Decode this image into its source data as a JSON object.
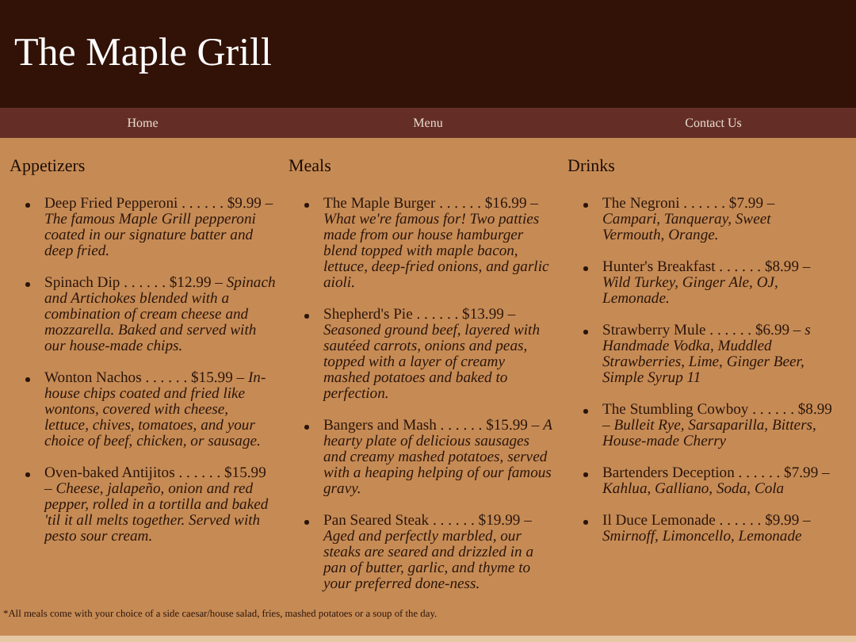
{
  "header": {
    "title": "The Maple Grill"
  },
  "nav": [
    {
      "label": "Home"
    },
    {
      "label": "Menu"
    },
    {
      "label": "Contact Us"
    }
  ],
  "sections": [
    {
      "heading": "Appetizers",
      "items": [
        {
          "text": "Deep Fried Pepperoni . . . . . . $9.99 – *The famous Maple Grill pepperoni coated in our signature batter and deep fried.*"
        },
        {
          "text": "Spinach Dip . . . . . . $12.99 – *Spinach and Artichokes blended with a combination of cream cheese and mozzarella. Baked and served with our house-made chips.*"
        },
        {
          "text": "Wonton Nachos . . . . . . $15.99 – *In-house chips coated and fried like wontons, covered with cheese, lettuce, chives, tomatoes, and your choice of beef, chicken, or sausage.*"
        },
        {
          "text": "Oven-baked Antijitos . . . . . . $15.99 – *Cheese, jalapeño, onion and red pepper, rolled in a tortilla and baked 'til it all melts together. Served with pesto sour cream.*"
        }
      ]
    },
    {
      "heading": "Meals",
      "items": [
        {
          "text": "The Maple Burger . . . . . . $16.99 – *What we're famous for! Two patties made from our house hamburger blend topped with maple bacon, lettuce, deep-fried onions, and garlic aioli.*"
        },
        {
          "text": "Shepherd's Pie . . . . . . $13.99 – *Seasoned ground beef, layered with sautéed carrots, onions and peas, topped with a layer of creamy mashed potatoes and baked to perfection.*"
        },
        {
          "text": "Bangers and Mash . . . . . . $15.99 – *A hearty plate of delicious sausages and creamy mashed potatoes, served with a heaping helping of our famous gravy.*"
        },
        {
          "text": "Pan Seared Steak . . . . . . $19.99 – *Aged and perfectly marbled, our steaks are seared and drizzled in a pan of butter, garlic, and thyme to your preferred done-ness.*"
        }
      ]
    },
    {
      "heading": "Drinks",
      "items": [
        {
          "text": "The Negroni . . . . . . $7.99 – *Campari, Tanqueray, Sweet Vermouth, Orange.*"
        },
        {
          "text": "Hunter's Breakfast . . . . . . $8.99 – *Wild Turkey, Ginger Ale, OJ, Lemonade.*"
        },
        {
          "text": "Strawberry Mule . . . . . . $6.99 – *s Handmade Vodka, Muddled Strawberries, Lime, Ginger Beer, Simple Syrup 11*"
        },
        {
          "text": "The Stumbling Cowboy . . . . . . $8.99 – *Bulleit Rye, Sarsaparilla, Bitters, House-made Cherry*"
        },
        {
          "text": "Bartenders Deception . . . . . . $7.99 – *Kahlua, Galliano, Soda, Cola*"
        },
        {
          "text": "Il Duce Lemonade . . . . . . $9.99 – *Smirnoff, Limoncello, Lemonade*"
        }
      ]
    }
  ],
  "footnote": "*All meals come with your choice of a side caesar/house salad, fries, mashed potatoes or a soup of the day."
}
